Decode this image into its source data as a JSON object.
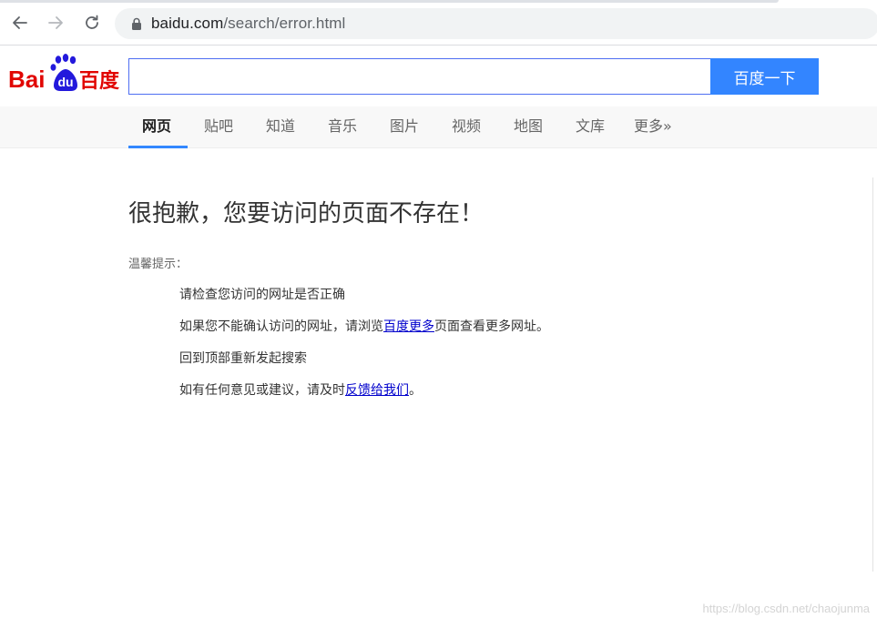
{
  "browser": {
    "url_host": "baidu.com",
    "url_path": "/search/error.html"
  },
  "header": {
    "logo_text_left": "Bai",
    "logo_paw_text": "du",
    "logo_text_right": "百度",
    "search_value": "",
    "search_button_label": "百度一下"
  },
  "navbar": {
    "items": [
      {
        "label": "网页",
        "active": true
      },
      {
        "label": "贴吧",
        "active": false
      },
      {
        "label": "知道",
        "active": false
      },
      {
        "label": "音乐",
        "active": false
      },
      {
        "label": "图片",
        "active": false
      },
      {
        "label": "视频",
        "active": false
      },
      {
        "label": "地图",
        "active": false
      },
      {
        "label": "文库",
        "active": false
      },
      {
        "label": "更多»",
        "active": false
      }
    ]
  },
  "main": {
    "title": "很抱歉，您要访问的页面不存在！",
    "tips_label": "温馨提示：",
    "tip1": "请检查您访问的网址是否正确",
    "tip2_before": "如果您不能确认访问的网址，请浏览",
    "tip2_link": "百度更多",
    "tip2_after": "页面查看更多网址。",
    "tip3": "回到顶部重新发起搜索",
    "tip4_before": "如有任何意见或建议，请及时",
    "tip4_link": "反馈给我们",
    "tip4_after": "。"
  },
  "watermark": "https://blog.csdn.net/chaojunma",
  "colors": {
    "brand_red": "#e10602",
    "brand_blue": "#2319dc",
    "search_button": "#3385ff",
    "active_tab_underline": "#3388ff",
    "link": "#0000cc"
  }
}
